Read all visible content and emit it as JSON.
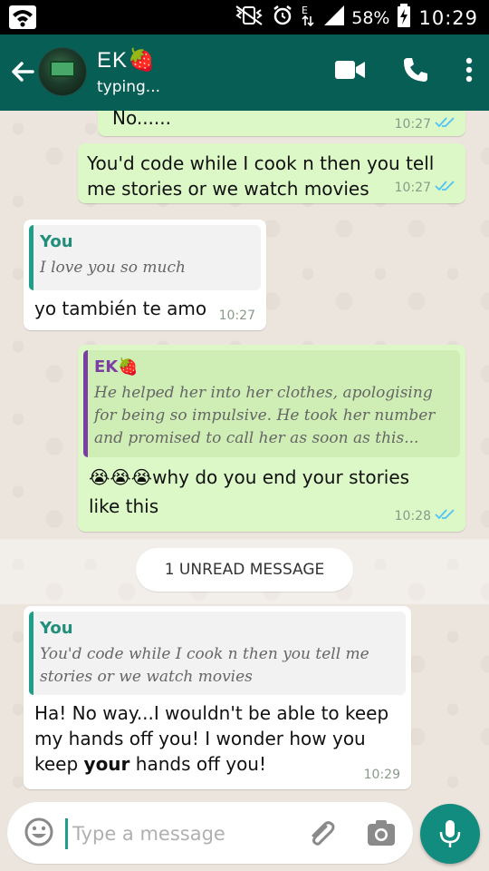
{
  "status_bar": {
    "battery": "58%",
    "time": "10:29",
    "icons": [
      "wifi-icon",
      "mute-vibrate-icon",
      "alarm-icon",
      "data-arrows-icon",
      "signal-icon",
      "battery-charging-icon"
    ]
  },
  "header": {
    "contact_name": "EK🍓",
    "contact_status": "typing...",
    "icons": [
      "back-arrow-icon",
      "video-call-icon",
      "phone-call-icon",
      "more-vert-icon"
    ]
  },
  "messages": [
    {
      "direction": "out",
      "text": "No......",
      "time": "10:27",
      "ticks": "read"
    },
    {
      "direction": "out",
      "text": "You'd code while I cook n then you tell me stories or we watch movies",
      "time": "10:27",
      "ticks": "read"
    },
    {
      "direction": "in",
      "quote": {
        "author": "You",
        "text": "I love you so much"
      },
      "text": "yo también te amo",
      "time": "10:27"
    },
    {
      "direction": "out",
      "quote": {
        "author": "EK🍓",
        "text": "He helped her into her clothes, apologising for being so impulsive. He took her number and promised to call her as soon as this..."
      },
      "text": "😭😭😭why do you end your stories like this",
      "time": "10:28",
      "ticks": "read"
    },
    {
      "direction": "in",
      "quote": {
        "author": "You",
        "text": "You'd code while I cook n then you tell me stories or we watch movies"
      },
      "text_parts": [
        "Ha! No way...I wouldn't be able to keep my hands off you! I wonder how you keep ",
        "your",
        " hands off you!"
      ],
      "time": "10:29"
    }
  ],
  "unread_label": "1 UNREAD MESSAGE",
  "composer": {
    "placeholder": "Type a message",
    "icons": [
      "emoji-icon",
      "attach-icon",
      "camera-icon",
      "mic-icon"
    ]
  },
  "colors": {
    "header": "#075e54",
    "outgoing_bubble": "#dcf8c6",
    "incoming_bubble": "#ffffff",
    "read_ticks": "#4fc3f7",
    "mic_button": "#128c7e"
  }
}
